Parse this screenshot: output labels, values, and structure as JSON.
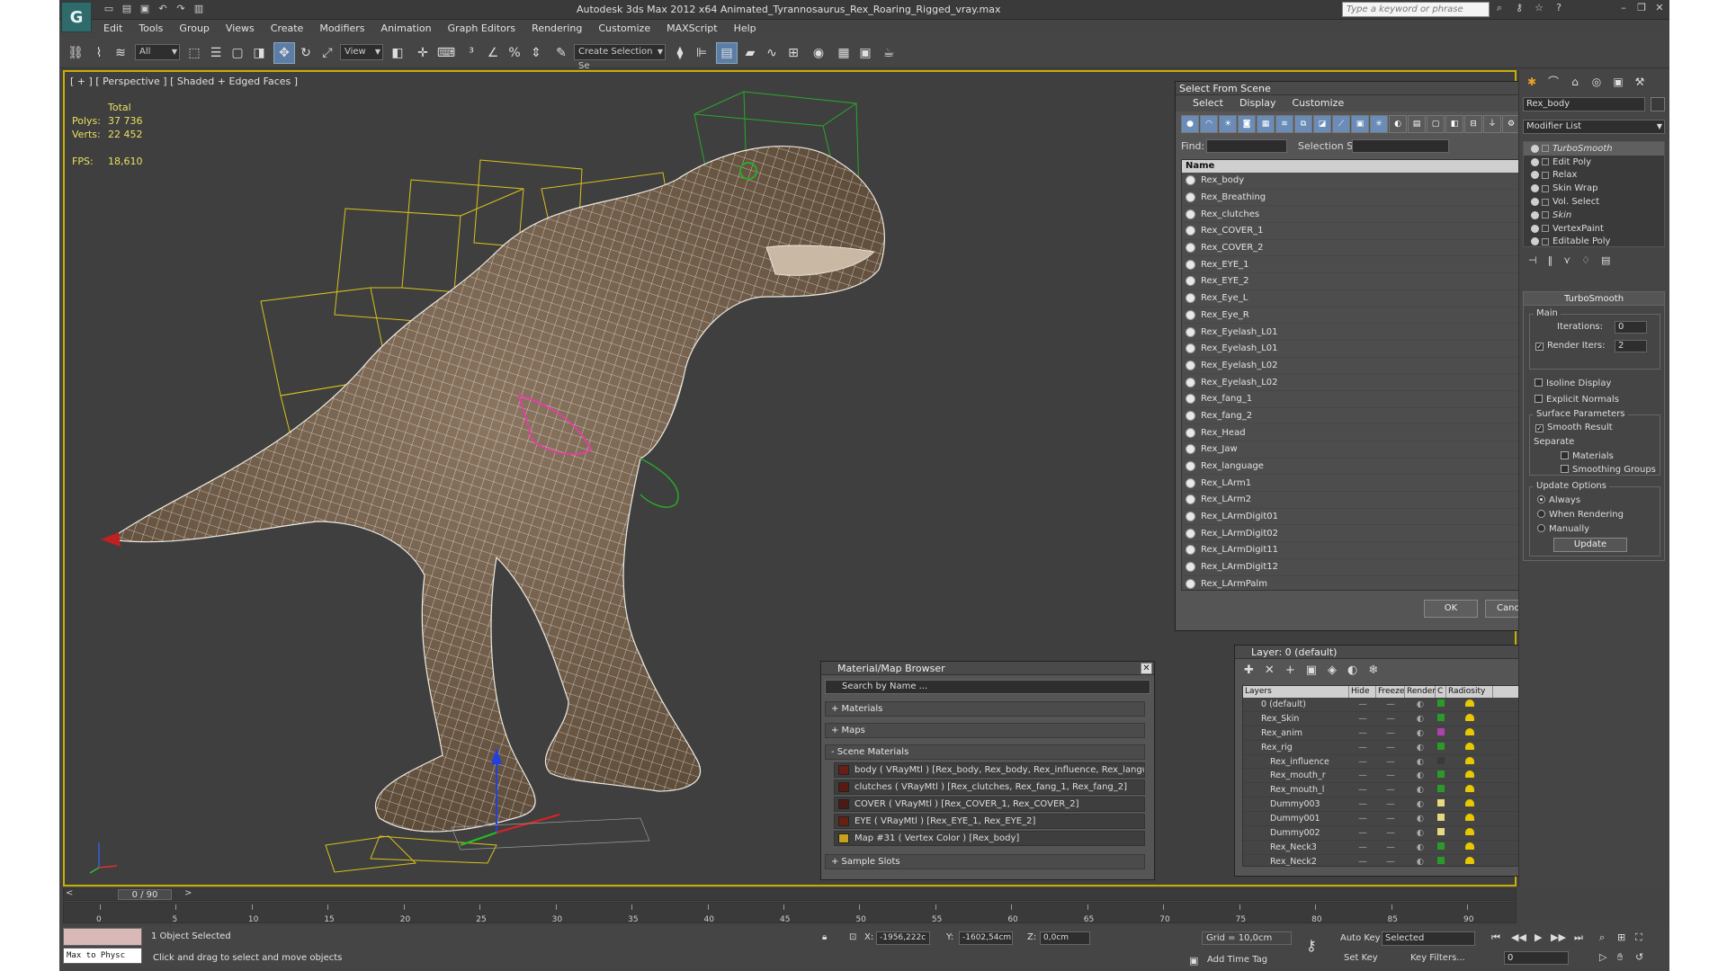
{
  "window": {
    "title": "Autodesk 3ds Max  2012 x64     Animated_Tyrannosaurus_Rex_Roaring_Rigged_vray.max",
    "search_placeholder": "Type a keyword or phrase"
  },
  "menu": [
    "Edit",
    "Tools",
    "Group",
    "Views",
    "Create",
    "Modifiers",
    "Animation",
    "Graph Editors",
    "Rendering",
    "Customize",
    "MAXScript",
    "Help"
  ],
  "toolbar": {
    "filter_value": "All",
    "refcoord_value": "View",
    "selection_set_placeholder": "Create Selection Se"
  },
  "viewport": {
    "label": "[ + ] [ Perspective ] [ Shaded + Edged Faces ]",
    "stats_header": "Total",
    "polys_label": "Polys:",
    "polys_value": "37 736",
    "verts_label": "Verts:",
    "verts_value": "22 452",
    "fps_label": "FPS:",
    "fps_value": "18,610"
  },
  "select_from_scene": {
    "title": "Select From Scene",
    "menu": [
      "Select",
      "Display",
      "Customize"
    ],
    "find_label": "Find:",
    "selection_set_label": "Selection Set:",
    "column_header": "Name",
    "items": [
      "Rex_body",
      "Rex_Breathing",
      "Rex_clutches",
      "Rex_COVER_1",
      "Rex_COVER_2",
      "Rex_EYE_1",
      "Rex_EYE_2",
      "Rex_Eye_L",
      "Rex_Eye_R",
      "Rex_Eyelash_L01",
      "Rex_Eyelash_L01",
      "Rex_Eyelash_L02",
      "Rex_Eyelash_L02",
      "Rex_fang_1",
      "Rex_fang_2",
      "Rex_Head",
      "Rex_Jaw",
      "Rex_language",
      "Rex_LArm1",
      "Rex_LArm2",
      "Rex_LArmDigit01",
      "Rex_LArmDigit02",
      "Rex_LArmDigit11",
      "Rex_LArmDigit12",
      "Rex_LArmPalm"
    ],
    "ok_label": "OK",
    "cancel_label": "Cancel"
  },
  "material_browser": {
    "title": "Material/Map Browser",
    "search_placeholder": "Search by Name ...",
    "sections": [
      "+ Materials",
      "+ Maps",
      "- Scene Materials",
      "+ Sample Slots"
    ],
    "scene_materials": [
      {
        "text": "body  ( VRayMtl ) [Rex_body, Rex_body, Rex_influence, Rex_language, Rex_mo...",
        "swatch": "#6a1e14"
      },
      {
        "text": "clutches  ( VRayMtl ) [Rex_clutches, Rex_fang_1, Rex_fang_2]",
        "swatch": "#5a1a10"
      },
      {
        "text": "COVER  ( VRayMtl ) [Rex_COVER_1, Rex_COVER_2]",
        "swatch": "#4a1a14"
      },
      {
        "text": "EYE  ( VRayMtl ) [Rex_EYE_1, Rex_EYE_2]",
        "swatch": "#6a2010"
      },
      {
        "text": "Map #31  ( Vertex Color ) [Rex_body]",
        "swatch": "#c8a020"
      }
    ]
  },
  "layer_dialog": {
    "title": "Layer: 0 (default)",
    "headers": [
      "Layers",
      "Hide",
      "Freeze",
      "Render",
      "C",
      "Radiosity"
    ],
    "rows": [
      {
        "name": "0 (default)",
        "color": "#2a9a2a"
      },
      {
        "name": "Rex_Skin",
        "color": "#2a9a2a"
      },
      {
        "name": "Rex_anim",
        "color": "#b040b0"
      },
      {
        "name": "Rex_rig",
        "color": "#2a9a2a"
      },
      {
        "name": "Rex_influence",
        "color": "#3a3a3a"
      },
      {
        "name": "Rex_mouth_r",
        "color": "#2a9a2a"
      },
      {
        "name": "Rex_mouth_l",
        "color": "#2a9a2a"
      },
      {
        "name": "Dummy003",
        "color": "#e8d880"
      },
      {
        "name": "Dummy001",
        "color": "#e8d880"
      },
      {
        "name": "Dummy002",
        "color": "#e8d880"
      },
      {
        "name": "Rex_Neck3",
        "color": "#2a9a2a"
      },
      {
        "name": "Rex_Neck2",
        "color": "#2a9a2a"
      }
    ]
  },
  "command_panel": {
    "object_name": "Rex_body",
    "modifier_list_label": "Modifier List",
    "stack": [
      "TurboSmooth",
      "Edit Poly",
      "Relax",
      "Skin Wrap",
      "Vol. Select",
      "Skin",
      "VertexPaint",
      "Editable Poly"
    ],
    "rollout_title": "TurboSmooth",
    "main_label": "Main",
    "iterations_label": "Iterations:",
    "iterations_value": "0",
    "render_iters_label": "Render Iters:",
    "render_iters_value": "2",
    "isoline_label": "Isoline Display",
    "explicit_normals_label": "Explicit Normals",
    "surface_params_label": "Surface Parameters",
    "smooth_result_label": "Smooth Result",
    "separate_label": "Separate",
    "materials_label": "Materials",
    "smoothing_groups_label": "Smoothing Groups",
    "update_options_label": "Update Options",
    "always_label": "Always",
    "when_rendering_label": "When Rendering",
    "manually_label": "Manually",
    "update_button": "Update"
  },
  "timeline": {
    "frame_display": "0 / 90",
    "ticks": [
      "0",
      "5",
      "10",
      "15",
      "20",
      "25",
      "30",
      "35",
      "40",
      "45",
      "50",
      "55",
      "60",
      "65",
      "70",
      "75",
      "80",
      "85",
      "90"
    ]
  },
  "status": {
    "maxscript_output": "Max to Physc",
    "selection": "1 Object Selected",
    "prompt": "Click and drag to select and move objects",
    "x_label": "X:",
    "x_value": "-1956,222c",
    "y_label": "Y:",
    "y_value": "-1602,54cm",
    "z_label": "Z:",
    "z_value": "0,0cm",
    "grid": "Grid = 10,0cm",
    "add_time_tag": "Add Time Tag",
    "auto_key": "Auto Key",
    "set_key": "Set Key",
    "key_mode_value": "Selected",
    "key_filters": "Key Filters...",
    "current_frame": "0"
  }
}
